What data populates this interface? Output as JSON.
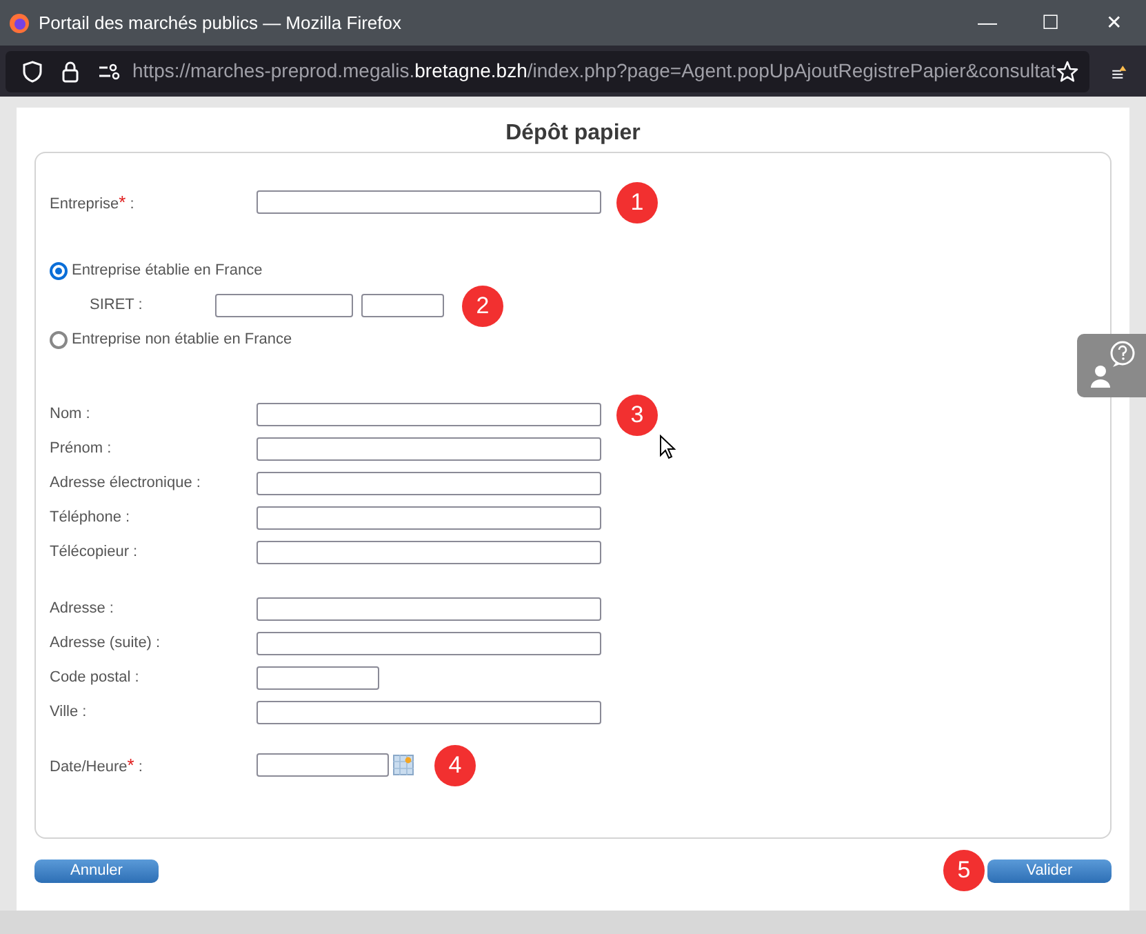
{
  "window": {
    "title": "Portail des marchés publics — Mozilla Firefox",
    "controls": [
      "—",
      "☐",
      "✕"
    ]
  },
  "address_bar": {
    "url_before": "https://marches-preprod.megalis.",
    "url_host": "bretagne.bzh",
    "url_after": "/index.php?page=Agent.popUpAjoutRegistrePapier&consultat"
  },
  "dialog": {
    "title": "Dépôt papier",
    "groups": [
      [
        {
          "kind": "text",
          "label": "Entreprise",
          "required_mark": "*",
          "colon": ":",
          "badge": "1"
        }
      ],
      [
        {
          "kind": "radio",
          "label": "Entreprise établie en France",
          "selected": true
        },
        {
          "kind": "siret",
          "label": "SIRET :",
          "badge": "2"
        },
        {
          "kind": "radio",
          "label": "Entreprise non établie en France",
          "selected": false
        }
      ],
      [
        {
          "kind": "text",
          "label": "Nom :",
          "badge": "3"
        },
        {
          "kind": "text",
          "label": "Prénom :"
        },
        {
          "kind": "text",
          "label": "Adresse électronique :"
        },
        {
          "kind": "text",
          "label": "Téléphone :"
        },
        {
          "kind": "text",
          "label": "Télécopieur :"
        }
      ],
      [
        {
          "kind": "text",
          "label": "Adresse :"
        },
        {
          "kind": "text",
          "label": "Adresse (suite) :"
        },
        {
          "kind": "postal",
          "label": "Code postal :"
        },
        {
          "kind": "text",
          "label": "Ville :"
        }
      ],
      [
        {
          "kind": "date",
          "label": "Date/Heure",
          "required_mark": "*",
          "colon": ":",
          "badge": "4"
        }
      ]
    ],
    "buttons": [
      {
        "label": "Annuler"
      },
      {
        "label": "Valider",
        "badge": "5"
      }
    ]
  }
}
